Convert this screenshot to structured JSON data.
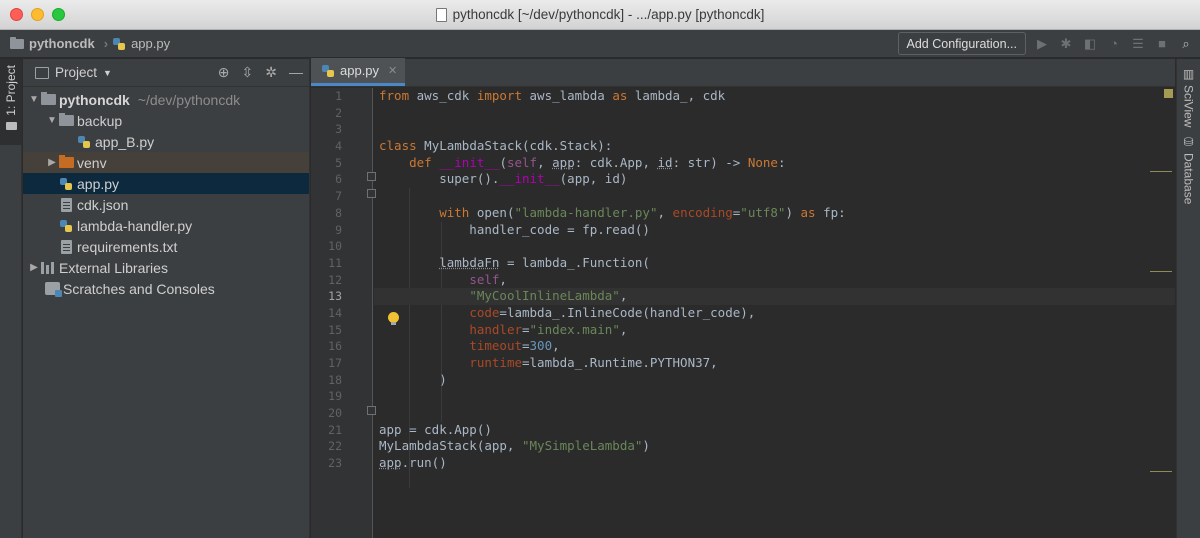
{
  "window": {
    "title": "pythoncdk [~/dev/pythoncdk] - .../app.py [pythoncdk]"
  },
  "navbar": {
    "crumbs": [
      "pythoncdk",
      "app.py"
    ],
    "add_config_label": "Add Configuration..."
  },
  "left_stripe": {
    "project_tab": "1: Project"
  },
  "project_panel": {
    "title": "Project",
    "tree": [
      {
        "label": "pythoncdk",
        "path": "~/dev/pythoncdk",
        "type": "folder",
        "expanded": true,
        "indent": 0
      },
      {
        "label": "backup",
        "type": "folder",
        "expanded": true,
        "indent": 1
      },
      {
        "label": "app_B.py",
        "type": "python",
        "indent": 2
      },
      {
        "label": "venv",
        "type": "folder-orange",
        "expanded": false,
        "indent": 1
      },
      {
        "label": "app.py",
        "type": "python",
        "indent": 1,
        "selected": true
      },
      {
        "label": "cdk.json",
        "type": "file",
        "indent": 1
      },
      {
        "label": "lambda-handler.py",
        "type": "python",
        "indent": 1
      },
      {
        "label": "requirements.txt",
        "type": "file",
        "indent": 1
      },
      {
        "label": "External Libraries",
        "type": "libs",
        "expanded": false,
        "indent": 0
      },
      {
        "label": "Scratches and Consoles",
        "type": "scratch",
        "indent": 0
      }
    ]
  },
  "editor": {
    "tab_label": "app.py",
    "current_line": 13,
    "line_numbers": [
      "1",
      "2",
      "3",
      "4",
      "5",
      "6",
      "7",
      "8",
      "9",
      "10",
      "11",
      "12",
      "13",
      "14",
      "15",
      "16",
      "17",
      "18",
      "19",
      "20",
      "21",
      "22",
      "23"
    ]
  },
  "right_stripe": {
    "items": [
      "SciView",
      "Database"
    ]
  },
  "colors": {
    "keyword": "#cc7832",
    "string": "#6a8759",
    "number": "#6897bb",
    "function_def": "#ffc66d",
    "self": "#94558d",
    "magic": "#b200b2",
    "selection": "#0d293e",
    "tab_accent": "#4a88c7"
  }
}
